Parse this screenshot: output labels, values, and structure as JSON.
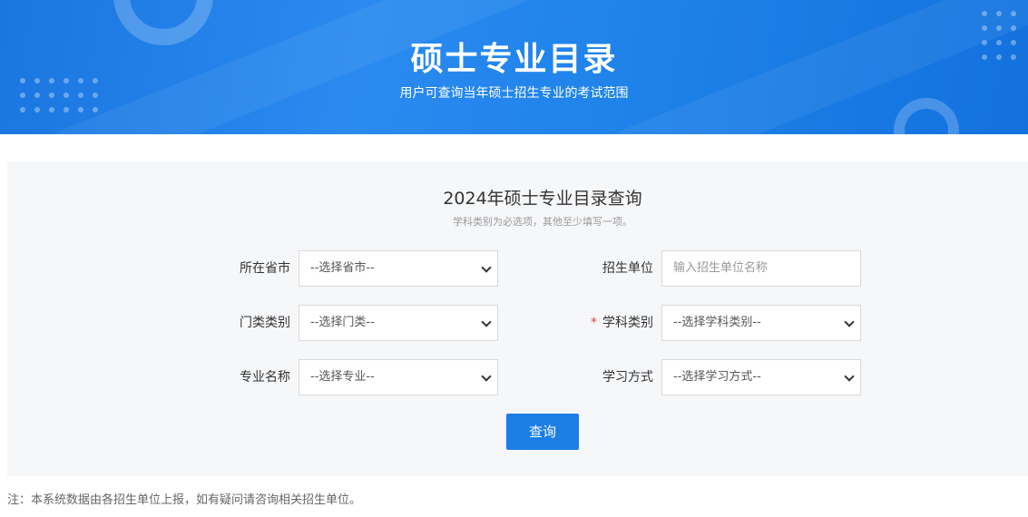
{
  "banner": {
    "title": "硕士专业目录",
    "subtitle": "用户可查询当年硕士招生专业的考试范围"
  },
  "form": {
    "title": "2024年硕士专业目录查询",
    "hint": "学科类别为必选项，其他至少填写一项。",
    "fields": {
      "province": {
        "label": "所在省市",
        "value": "--选择省市--"
      },
      "unit": {
        "label": "招生单位",
        "placeholder": "输入招生单位名称"
      },
      "category": {
        "label": "门类类别",
        "value": "--选择门类--"
      },
      "discipline": {
        "label": "学科类别",
        "value": "--选择学科类别--",
        "required_mark": "*"
      },
      "major": {
        "label": "专业名称",
        "value": "--选择专业--"
      },
      "study_mode": {
        "label": "学习方式",
        "value": "--选择学习方式--"
      }
    },
    "submit_label": "查询"
  },
  "footnote": "注：本系统数据由各招生单位上报，如有疑问请咨询相关招生单位。",
  "colors": {
    "banner_blue": "#1f83ea",
    "button_blue": "#1a7ee6",
    "required_red": "#e4393c",
    "panel_bg": "#f6f7f9"
  }
}
